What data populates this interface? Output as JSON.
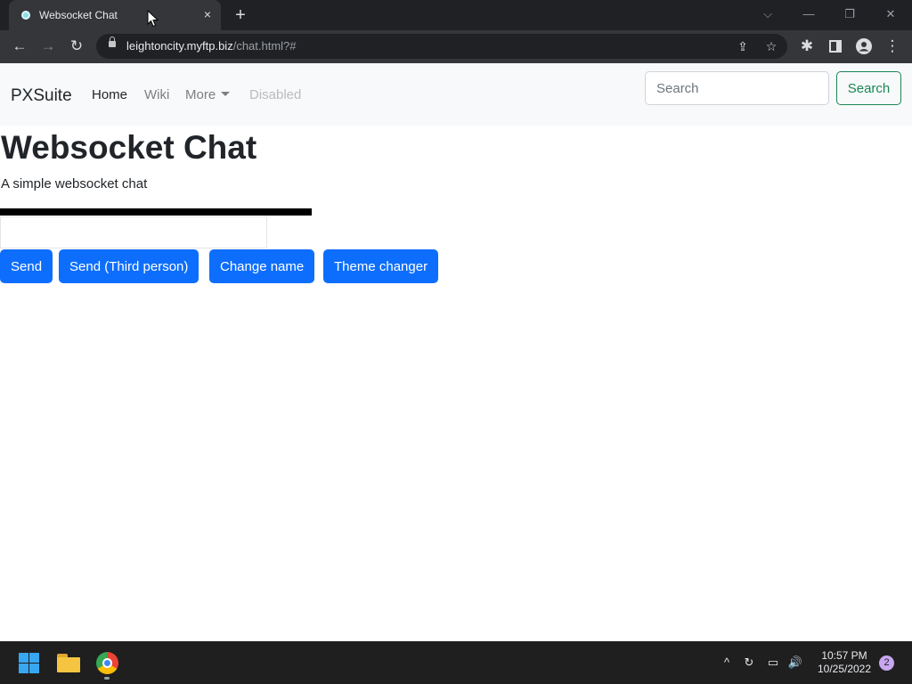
{
  "browser": {
    "tab_title": "Websocket Chat",
    "tab_close_icon": "×",
    "new_tab_icon": "+",
    "url_host": "leightoncity.myftp.biz",
    "url_path": "/chat.html?#",
    "controls": {
      "tab_search": "⌵",
      "minimize": "—",
      "restore": "❐",
      "close": "✕"
    },
    "toolbar": {
      "back": "←",
      "forward": "→",
      "reload": "↻",
      "share": "⇪",
      "bookmark": "☆",
      "extensions": "✱",
      "menu": "⋮"
    }
  },
  "navbar": {
    "brand": "PXSuite",
    "links": [
      {
        "label": "Home",
        "state": "active"
      },
      {
        "label": "Wiki",
        "state": "normal"
      },
      {
        "label": "More",
        "state": "dropdown"
      },
      {
        "label": "Disabled",
        "state": "disabled"
      }
    ],
    "search_placeholder": "Search",
    "search_button": "Search"
  },
  "main": {
    "title": "Websocket Chat",
    "subtitle": "A simple websocket chat",
    "message_value": "",
    "buttons": [
      "Send",
      "Send (Third person)",
      "Change name",
      "Theme changer"
    ]
  },
  "taskbar": {
    "time": "10:57 PM",
    "date": "10/25/2022",
    "notifications": "2",
    "tray_icons": {
      "chevron": "^",
      "sync": "↻",
      "network": "▭",
      "volume": "🔊"
    }
  },
  "colors": {
    "primary": "#0d6efd",
    "success": "#198754",
    "chrome_dark": "#202124",
    "chrome_toolbar": "#35363a",
    "taskbar": "#1f1f1f"
  }
}
